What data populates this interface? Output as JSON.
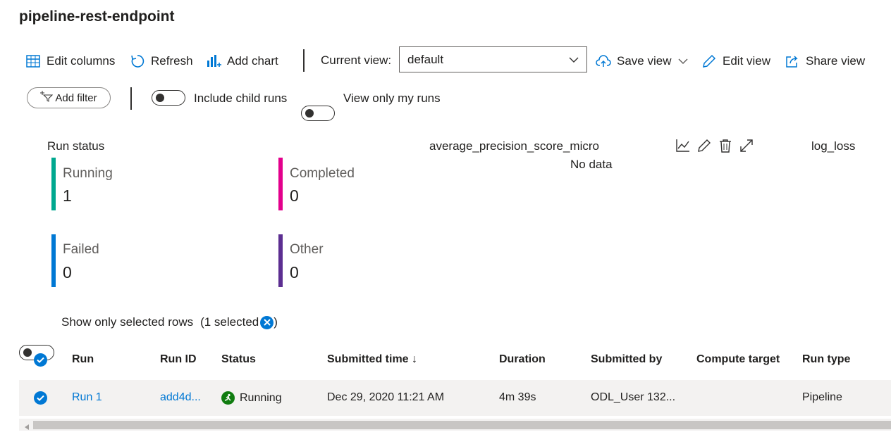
{
  "page_title": "pipeline-rest-endpoint",
  "toolbar": {
    "edit_columns": "Edit columns",
    "refresh": "Refresh",
    "add_chart": "Add chart",
    "current_view_label": "Current view:",
    "current_view_value": "default",
    "save_view": "Save view",
    "edit_view": "Edit view",
    "share_view": "Share view"
  },
  "filters": {
    "add_filter": "Add filter",
    "include_child_runs": "Include child runs",
    "view_only_my_runs": "View only my runs"
  },
  "run_status": {
    "title": "Run status",
    "items": [
      {
        "label": "Running",
        "value": "1",
        "color": "#00a88f"
      },
      {
        "label": "Completed",
        "value": "0",
        "color": "#e3008c"
      },
      {
        "label": "Failed",
        "value": "0",
        "color": "#0078d4"
      },
      {
        "label": "Other",
        "value": "0",
        "color": "#5c2e91"
      }
    ]
  },
  "chart_panel": {
    "metric": "average_precision_score_micro",
    "empty_text": "No data",
    "next_metric": "log_loss"
  },
  "selection": {
    "show_selected_label": "Show only selected rows",
    "selected_count_text": "(1 selected",
    "close_paren": ")"
  },
  "table": {
    "columns": [
      "Run",
      "Run ID",
      "Status",
      "Submitted time ↓",
      "Duration",
      "Submitted by",
      "Compute target",
      "Run type"
    ],
    "rows": [
      {
        "run": "Run 1",
        "run_id": "add4d...",
        "status": "Running",
        "submitted_time": "Dec 29, 2020 11:21 AM",
        "duration": "4m 39s",
        "submitted_by": "ODL_User 132...",
        "compute_target": "",
        "run_type": "Pipeline"
      }
    ]
  }
}
